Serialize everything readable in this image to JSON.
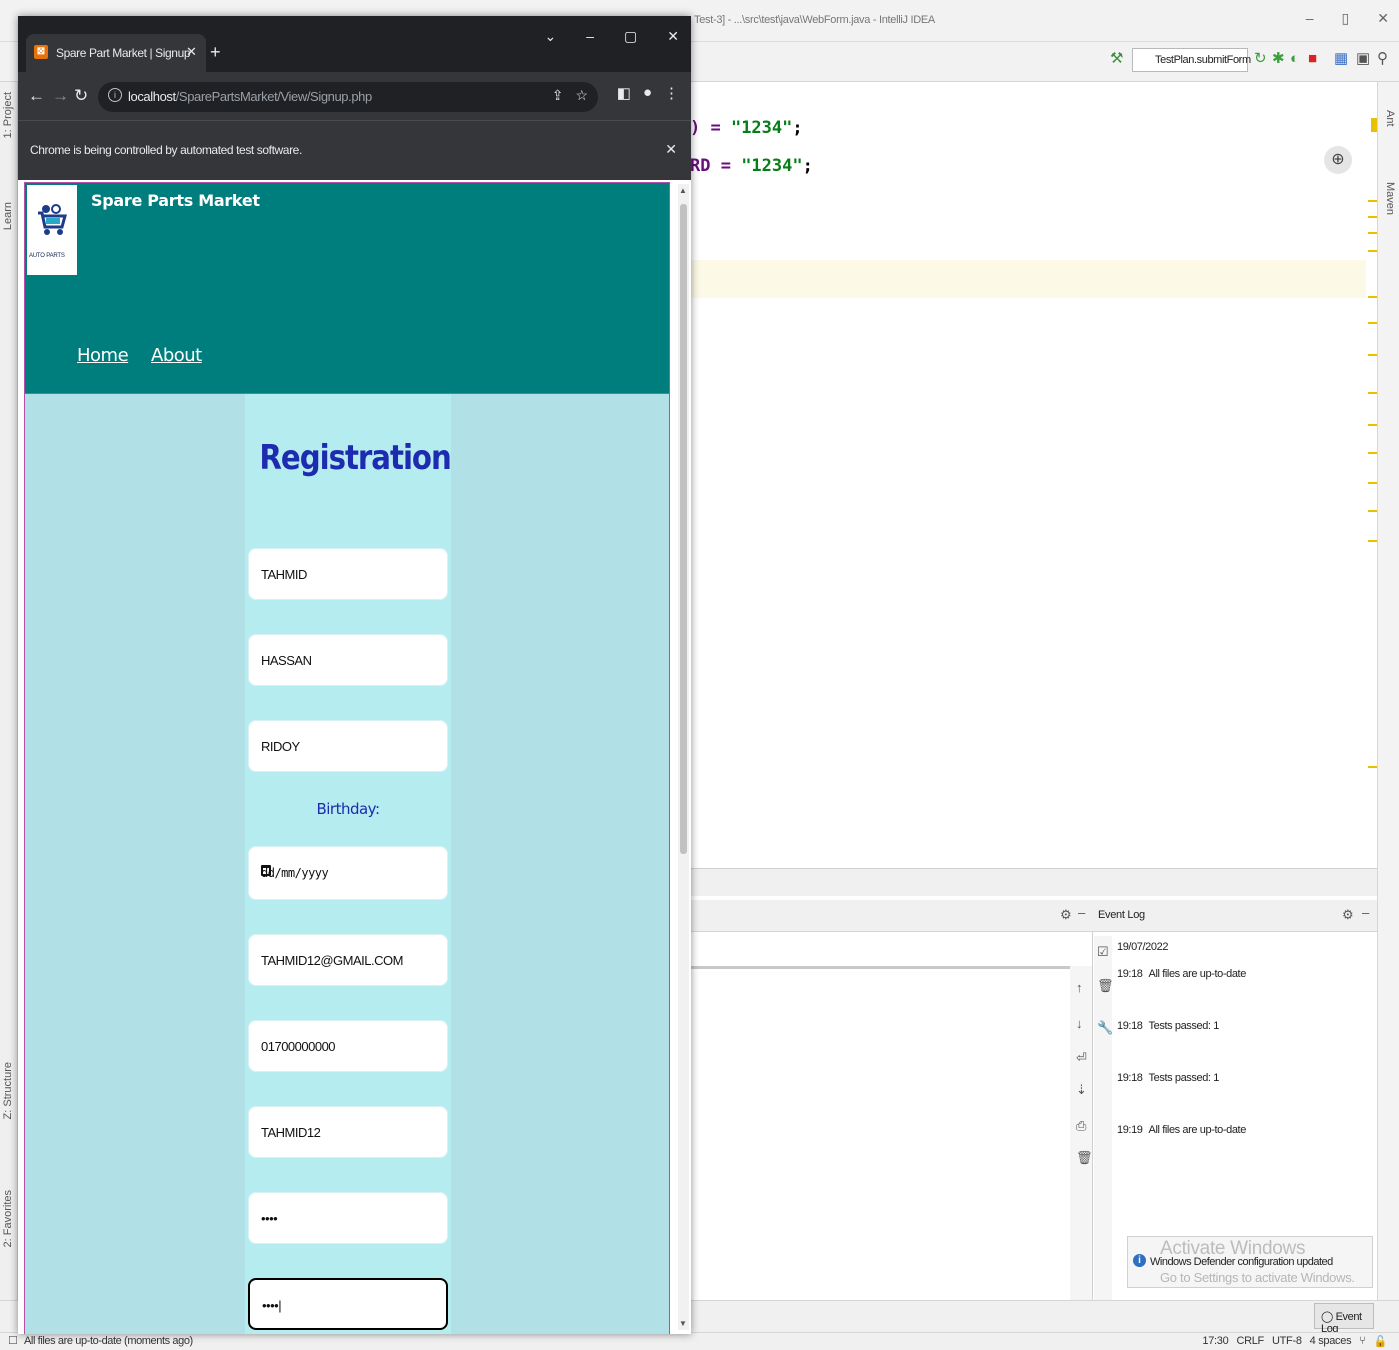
{
  "ide": {
    "window_title": "Test-3] - ...\\src\\test\\java\\WebForm.java - IntelliJ IDEA",
    "run_config": "TestPlan.submitForm",
    "left_tabs": [
      "1: Project",
      "Learn",
      "Z: Structure",
      "2: Favorites"
    ],
    "right_tabs": [
      "Ant",
      "Maven"
    ],
    "code_line_1": {
      "prefix": ") = ",
      "value": "\"1234\"",
      "end": ";"
    },
    "code_line_2": {
      "prefix": "RD = ",
      "value": "\"1234\"",
      "end": ";"
    },
    "event_log": {
      "title": "Event Log",
      "date": "19/07/2022",
      "entries": [
        {
          "time": "19:18",
          "text": "All files are up-to-date"
        },
        {
          "time": "19:18",
          "text": "Tests passed: 1"
        },
        {
          "time": "19:18",
          "text": "Tests passed: 1"
        },
        {
          "time": "19:19",
          "text": "All files are up-to-date"
        }
      ],
      "tab_label": "Event Log"
    },
    "notification": "Windows Defender configuration updated",
    "watermark_1": "Activate Windows",
    "watermark_2": "Go to Settings to activate Windows.",
    "status_text": "All files are up-to-date (moments ago)",
    "status_right": [
      "17:30",
      "CRLF",
      "UTF-8",
      "4 spaces"
    ]
  },
  "chrome": {
    "tab_title": "Spare Part Market | Signup",
    "url_host": "localhost",
    "url_path": "/SparePartsMarket/View/Signup.php",
    "info_bar": "Chrome is being controlled by automated test software."
  },
  "site": {
    "name": "Spare Parts Market",
    "logo_text": "AUTO PARTS",
    "nav": [
      "Home",
      "About"
    ],
    "form_title": "Registration",
    "birthday_label": "Birthday:",
    "fields": {
      "first_name": "TAHMID",
      "middle_name": "HASSAN",
      "last_name": "RIDOY",
      "birthday": "dd/mm/yyyy",
      "email": "TAHMID12@GMAIL.COM",
      "phone": "01700000000",
      "username": "TAHMID12",
      "password": "••••",
      "confirm_password": "••••|"
    }
  }
}
